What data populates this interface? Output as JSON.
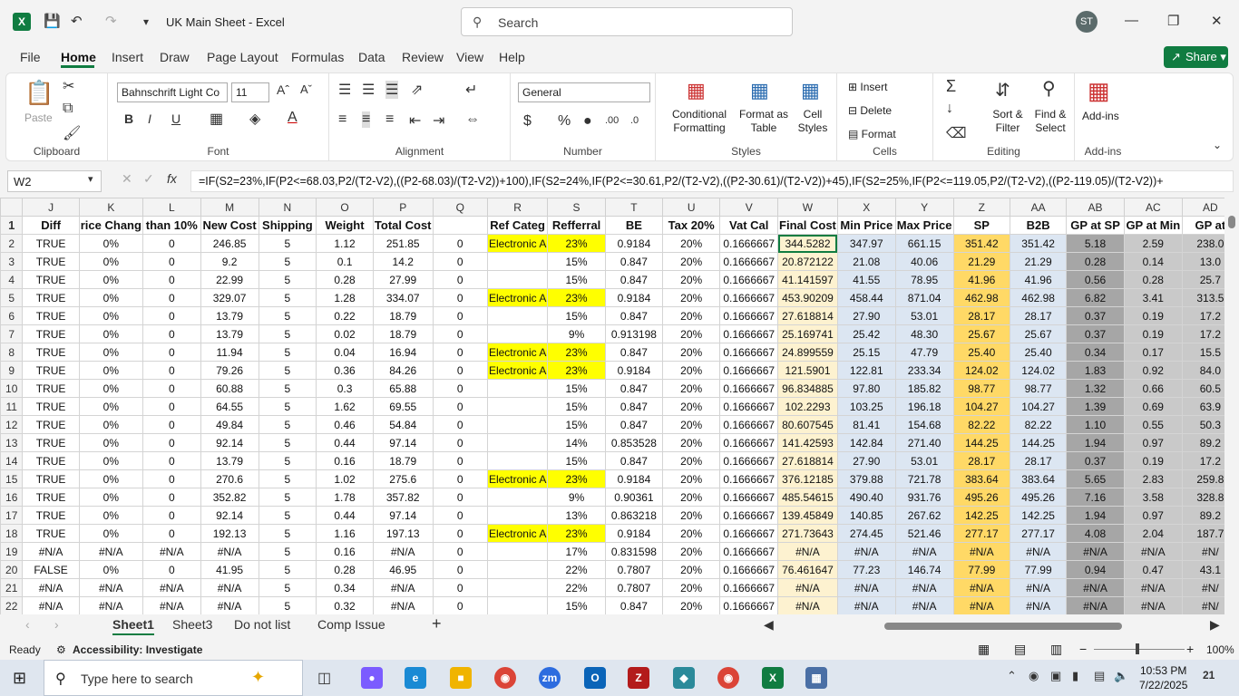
{
  "window": {
    "title": "UK Main Sheet  -  Excel",
    "user_initials": "ST"
  },
  "search": {
    "placeholder": "Search"
  },
  "menu": {
    "tabs": [
      "File",
      "Home",
      "Insert",
      "Draw",
      "Page Layout",
      "Formulas",
      "Data",
      "Review",
      "View",
      "Help"
    ],
    "active": "Home",
    "share": "Share"
  },
  "ribbon": {
    "clipboard": {
      "label": "Clipboard",
      "paste": "Paste"
    },
    "font": {
      "label": "Font",
      "family": "Bahnschrift Light Co",
      "size": "11"
    },
    "alignment": {
      "label": "Alignment"
    },
    "number": {
      "label": "Number",
      "format": "General"
    },
    "styles": {
      "label": "Styles",
      "conditional": "Conditional",
      "conditional2": "Formatting",
      "format_table": "Format as",
      "format_table2": "Table",
      "cell_styles": "Cell",
      "cell_styles2": "Styles"
    },
    "cells": {
      "label": "Cells",
      "insert": "Insert",
      "delete": "Delete",
      "format": "Format"
    },
    "editing": {
      "label": "Editing",
      "sort": "Sort &",
      "sort2": "Filter",
      "find": "Find &",
      "find2": "Select"
    },
    "addins": {
      "label": "Add-ins",
      "btn": "Add-ins"
    }
  },
  "formula_bar": {
    "name_box": "W2",
    "formula": "=IF(S2=23%,IF(P2<=68.03,P2/(T2-V2),((P2-68.03)/(T2-V2))+100),IF(S2=24%,IF(P2<=30.61,P2/(T2-V2),((P2-30.61)/(T2-V2))+45),IF(S2=25%,IF(P2<=119.05,P2/(T2-V2),((P2-119.05)/(T2-V2))+"
  },
  "grid": {
    "columns": [
      "J",
      "K",
      "L",
      "M",
      "N",
      "O",
      "P",
      "Q",
      "R",
      "S",
      "T",
      "U",
      "V",
      "W",
      "X",
      "Y",
      "Z",
      "AA",
      "AB",
      "AC",
      "AD"
    ],
    "headers": [
      "Diff",
      "rice Chang",
      "than 10%",
      "New Cost",
      "Shipping",
      "Weight",
      "Total Cost",
      "",
      "Ref Categ",
      "Refferral",
      "BE",
      "Tax 20%",
      "Vat Cal",
      "Final Cost",
      "Min Price",
      "Max Price",
      "SP",
      "B2B",
      "GP at SP",
      "GP at Min",
      "GP at"
    ],
    "rows": [
      [
        "2",
        "TRUE",
        "0%",
        "0",
        "246.85",
        "5",
        "1.12",
        "251.85",
        "0",
        "Electronic A",
        "23%",
        "0.9184",
        "20%",
        "0.1666667",
        "344.5282",
        "347.97",
        "661.15",
        "351.42",
        "351.42",
        "5.18",
        "2.59",
        "238.0"
      ],
      [
        "3",
        "TRUE",
        "0%",
        "0",
        "9.2",
        "5",
        "0.1",
        "14.2",
        "0",
        "",
        "15%",
        "0.847",
        "20%",
        "0.1666667",
        "20.872122",
        "21.08",
        "40.06",
        "21.29",
        "21.29",
        "0.28",
        "0.14",
        "13.0"
      ],
      [
        "4",
        "TRUE",
        "0%",
        "0",
        "22.99",
        "5",
        "0.28",
        "27.99",
        "0",
        "",
        "15%",
        "0.847",
        "20%",
        "0.1666667",
        "41.141597",
        "41.55",
        "78.95",
        "41.96",
        "41.96",
        "0.56",
        "0.28",
        "25.7"
      ],
      [
        "5",
        "TRUE",
        "0%",
        "0",
        "329.07",
        "5",
        "1.28",
        "334.07",
        "0",
        "Electronic A",
        "23%",
        "0.9184",
        "20%",
        "0.1666667",
        "453.90209",
        "458.44",
        "871.04",
        "462.98",
        "462.98",
        "6.82",
        "3.41",
        "313.5"
      ],
      [
        "6",
        "TRUE",
        "0%",
        "0",
        "13.79",
        "5",
        "0.22",
        "18.79",
        "0",
        "",
        "15%",
        "0.847",
        "20%",
        "0.1666667",
        "27.618814",
        "27.90",
        "53.01",
        "28.17",
        "28.17",
        "0.37",
        "0.19",
        "17.2"
      ],
      [
        "7",
        "TRUE",
        "0%",
        "0",
        "13.79",
        "5",
        "0.02",
        "18.79",
        "0",
        "",
        "9%",
        "0.913198",
        "20%",
        "0.1666667",
        "25.169741",
        "25.42",
        "48.30",
        "25.67",
        "25.67",
        "0.37",
        "0.19",
        "17.2"
      ],
      [
        "8",
        "TRUE",
        "0%",
        "0",
        "11.94",
        "5",
        "0.04",
        "16.94",
        "0",
        "Electronic A",
        "23%",
        "0.847",
        "20%",
        "0.1666667",
        "24.899559",
        "25.15",
        "47.79",
        "25.40",
        "25.40",
        "0.34",
        "0.17",
        "15.5"
      ],
      [
        "9",
        "TRUE",
        "0%",
        "0",
        "79.26",
        "5",
        "0.36",
        "84.26",
        "0",
        "Electronic A",
        "23%",
        "0.9184",
        "20%",
        "0.1666667",
        "121.5901",
        "122.81",
        "233.34",
        "124.02",
        "124.02",
        "1.83",
        "0.92",
        "84.0"
      ],
      [
        "10",
        "TRUE",
        "0%",
        "0",
        "60.88",
        "5",
        "0.3",
        "65.88",
        "0",
        "",
        "15%",
        "0.847",
        "20%",
        "0.1666667",
        "96.834885",
        "97.80",
        "185.82",
        "98.77",
        "98.77",
        "1.32",
        "0.66",
        "60.5"
      ],
      [
        "11",
        "TRUE",
        "0%",
        "0",
        "64.55",
        "5",
        "1.62",
        "69.55",
        "0",
        "",
        "15%",
        "0.847",
        "20%",
        "0.1666667",
        "102.2293",
        "103.25",
        "196.18",
        "104.27",
        "104.27",
        "1.39",
        "0.69",
        "63.9"
      ],
      [
        "12",
        "TRUE",
        "0%",
        "0",
        "49.84",
        "5",
        "0.46",
        "54.84",
        "0",
        "",
        "15%",
        "0.847",
        "20%",
        "0.1666667",
        "80.607545",
        "81.41",
        "154.68",
        "82.22",
        "82.22",
        "1.10",
        "0.55",
        "50.3"
      ],
      [
        "13",
        "TRUE",
        "0%",
        "0",
        "92.14",
        "5",
        "0.44",
        "97.14",
        "0",
        "",
        "14%",
        "0.853528",
        "20%",
        "0.1666667",
        "141.42593",
        "142.84",
        "271.40",
        "144.25",
        "144.25",
        "1.94",
        "0.97",
        "89.2"
      ],
      [
        "14",
        "TRUE",
        "0%",
        "0",
        "13.79",
        "5",
        "0.16",
        "18.79",
        "0",
        "",
        "15%",
        "0.847",
        "20%",
        "0.1666667",
        "27.618814",
        "27.90",
        "53.01",
        "28.17",
        "28.17",
        "0.37",
        "0.19",
        "17.2"
      ],
      [
        "15",
        "TRUE",
        "0%",
        "0",
        "270.6",
        "5",
        "1.02",
        "275.6",
        "0",
        "Electronic A",
        "23%",
        "0.9184",
        "20%",
        "0.1666667",
        "376.12185",
        "379.88",
        "721.78",
        "383.64",
        "383.64",
        "5.65",
        "2.83",
        "259.8"
      ],
      [
        "16",
        "TRUE",
        "0%",
        "0",
        "352.82",
        "5",
        "1.78",
        "357.82",
        "0",
        "",
        "9%",
        "0.90361",
        "20%",
        "0.1666667",
        "485.54615",
        "490.40",
        "931.76",
        "495.26",
        "495.26",
        "7.16",
        "3.58",
        "328.8"
      ],
      [
        "17",
        "TRUE",
        "0%",
        "0",
        "92.14",
        "5",
        "0.44",
        "97.14",
        "0",
        "",
        "13%",
        "0.863218",
        "20%",
        "0.1666667",
        "139.45849",
        "140.85",
        "267.62",
        "142.25",
        "142.25",
        "1.94",
        "0.97",
        "89.2"
      ],
      [
        "18",
        "TRUE",
        "0%",
        "0",
        "192.13",
        "5",
        "1.16",
        "197.13",
        "0",
        "Electronic A",
        "23%",
        "0.9184",
        "20%",
        "0.1666667",
        "271.73643",
        "274.45",
        "521.46",
        "277.17",
        "277.17",
        "4.08",
        "2.04",
        "187.7"
      ],
      [
        "19",
        "#N/A",
        "#N/A",
        "#N/A",
        "#N/A",
        "5",
        "0.16",
        "#N/A",
        "0",
        "",
        "17%",
        "0.831598",
        "20%",
        "0.1666667",
        "#N/A",
        "#N/A",
        "#N/A",
        "#N/A",
        "#N/A",
        "#N/A",
        "#N/A",
        "#N/"
      ],
      [
        "20",
        "FALSE",
        "0%",
        "0",
        "41.95",
        "5",
        "0.28",
        "46.95",
        "0",
        "",
        "22%",
        "0.7807",
        "20%",
        "0.1666667",
        "76.461647",
        "77.23",
        "146.74",
        "77.99",
        "77.99",
        "0.94",
        "0.47",
        "43.1"
      ],
      [
        "21",
        "#N/A",
        "#N/A",
        "#N/A",
        "#N/A",
        "5",
        "0.34",
        "#N/A",
        "0",
        "",
        "22%",
        "0.7807",
        "20%",
        "0.1666667",
        "#N/A",
        "#N/A",
        "#N/A",
        "#N/A",
        "#N/A",
        "#N/A",
        "#N/A",
        "#N/"
      ],
      [
        "22",
        "#N/A",
        "#N/A",
        "#N/A",
        "#N/A",
        "5",
        "0.32",
        "#N/A",
        "0",
        "",
        "15%",
        "0.847",
        "20%",
        "0.1666667",
        "#N/A",
        "#N/A",
        "#N/A",
        "#N/A",
        "#N/A",
        "#N/A",
        "#N/A",
        "#N/"
      ]
    ]
  },
  "sheets": {
    "tabs": [
      "Sheet1",
      "Sheet3",
      "Do not list",
      "Comp Issue"
    ],
    "active": "Sheet1"
  },
  "status": {
    "ready": "Ready",
    "accessibility": "Accessibility: Investigate",
    "zoom": "100%"
  },
  "taskbar": {
    "search_placeholder": "Type here to search",
    "time": "10:53 PM",
    "date": "7/22/2025",
    "notifications": "21"
  },
  "colors": {
    "accent": "#107c41",
    "yellow": "#ffff00",
    "sp": "#ffd966",
    "gp": "#a6a6a6"
  }
}
